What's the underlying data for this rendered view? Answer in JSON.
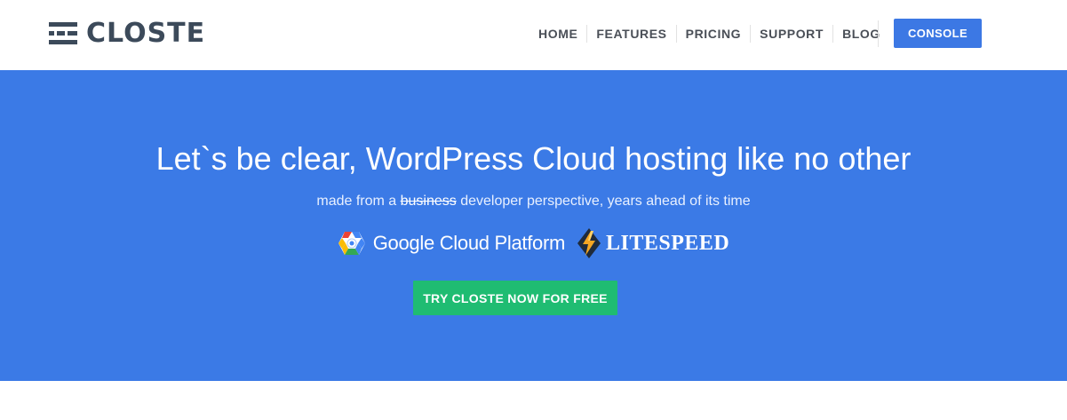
{
  "brand": {
    "name": "CLOSTE",
    "logo_icon": "stacked-bars-logo-icon"
  },
  "nav": {
    "items": [
      {
        "label": "HOME"
      },
      {
        "label": "FEATURES"
      },
      {
        "label": "PRICING"
      },
      {
        "label": "SUPPORT"
      },
      {
        "label": "BLOG"
      }
    ],
    "console_label": "CONSOLE"
  },
  "hero": {
    "title": "Let`s be clear, WordPress Cloud hosting like no other",
    "subtitle_prefix": "made from a ",
    "subtitle_struck": "business",
    "subtitle_suffix": " developer perspective, years ahead of its time",
    "partners": {
      "gcp_label": "Google Cloud Platform",
      "gcp_icon": "google-cloud-hexagon-icon",
      "litespeed_label": "LITESPEED",
      "litespeed_icon": "litespeed-lightning-icon"
    },
    "cta_label": "TRY CLOSTE NOW FOR FREE"
  },
  "colors": {
    "hero_bg": "#3b7ae6",
    "console_btn": "#3c78e4",
    "cta_btn": "#1fbc72",
    "logo_text": "#3c4a5a"
  }
}
